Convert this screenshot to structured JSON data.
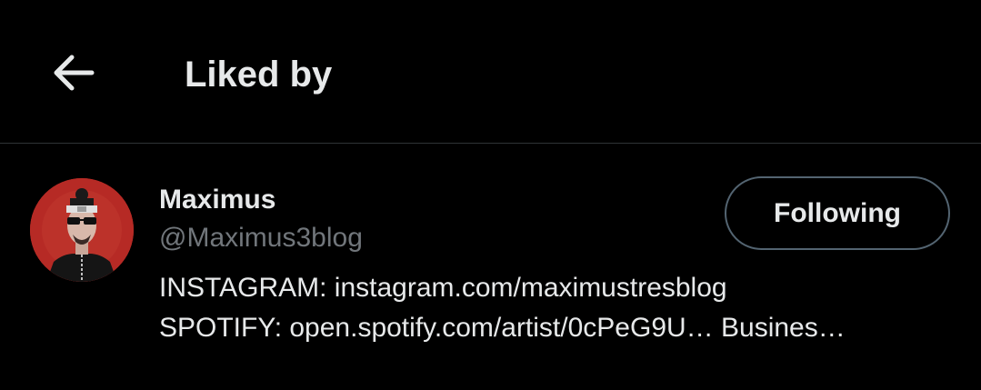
{
  "header": {
    "back_icon": "arrow-left-icon",
    "title": "Liked by"
  },
  "users": [
    {
      "name": "Maximus",
      "handle": "@Maximus3blog",
      "bio_lines": [
        "INSTAGRAM: instagram.com/maximustresblog",
        "SPOTIFY: open.spotify.com/artist/0cPeG9U… Busines…"
      ],
      "follow_label": "Following",
      "avatar_bg": "#b62a25"
    }
  ],
  "colors": {
    "background": "#000000",
    "primary_text": "#e7e9ea",
    "secondary_text": "#71767b",
    "divider": "#2f3336",
    "button_border": "#536471"
  }
}
